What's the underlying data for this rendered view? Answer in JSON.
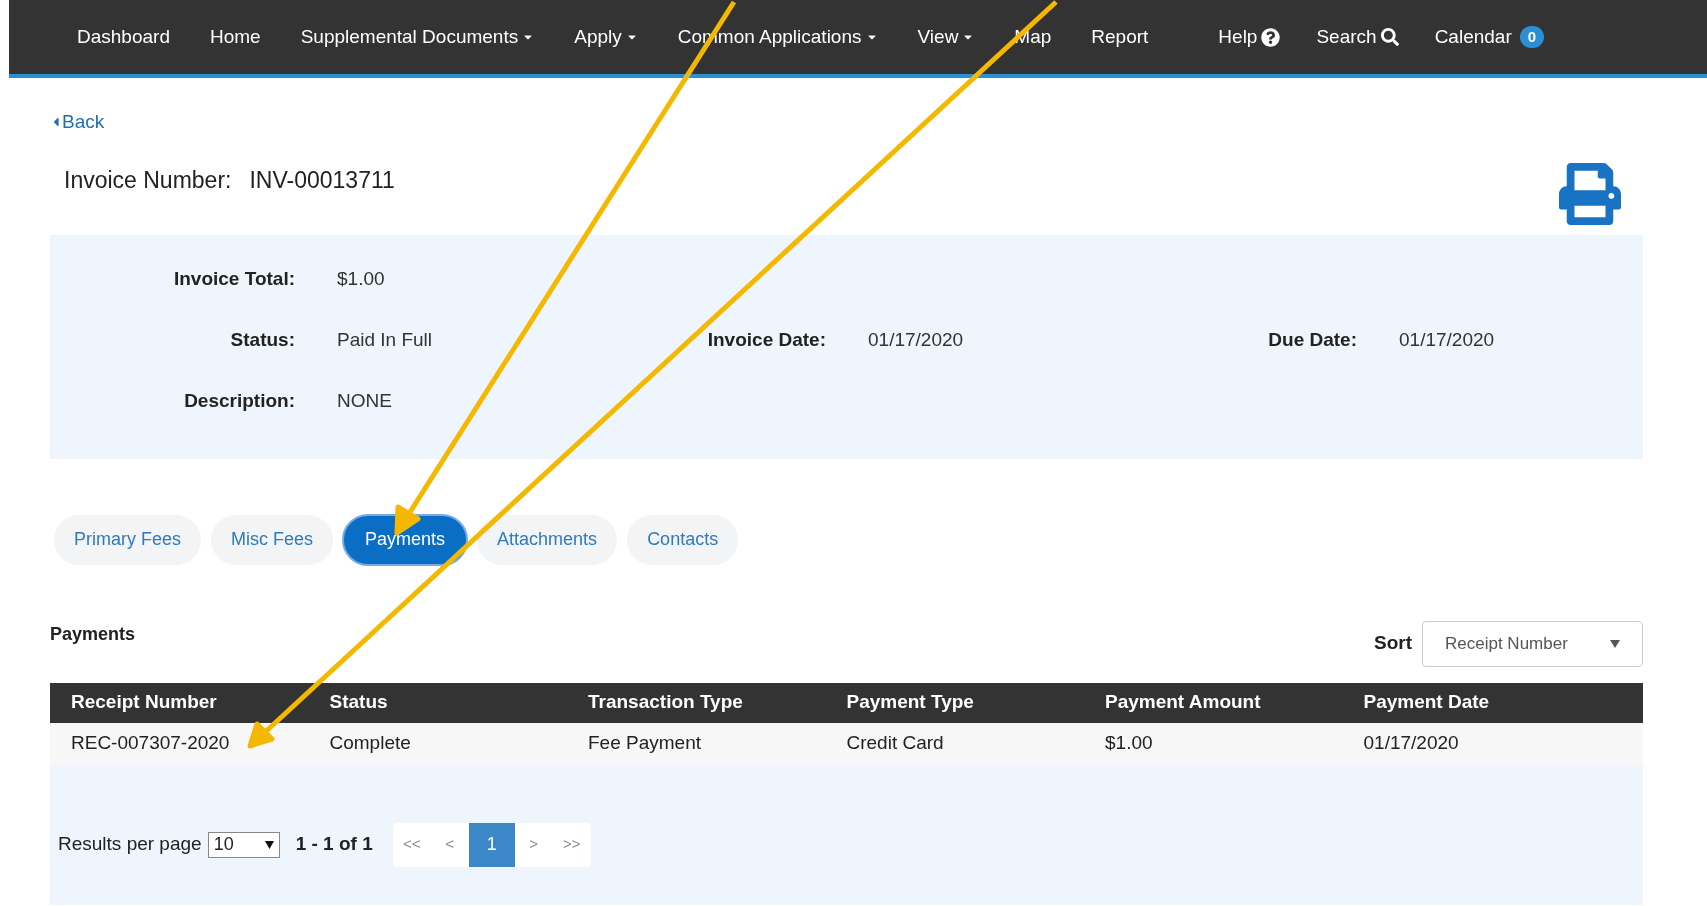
{
  "nav": {
    "items": [
      {
        "label": "Dashboard",
        "dropdown": false
      },
      {
        "label": "Home",
        "dropdown": false
      },
      {
        "label": "Supplemental Documents",
        "dropdown": true
      },
      {
        "label": "Apply",
        "dropdown": true
      },
      {
        "label": "Common Applications",
        "dropdown": true
      },
      {
        "label": "View",
        "dropdown": true
      },
      {
        "label": "Map",
        "dropdown": false
      },
      {
        "label": "Report",
        "dropdown": false
      }
    ],
    "right": [
      {
        "label": "Help",
        "kind": "help"
      },
      {
        "label": "Search",
        "kind": "search"
      },
      {
        "label": "Calendar",
        "kind": "badge",
        "badge": "0"
      }
    ]
  },
  "back": "Back",
  "invoice": {
    "label": "Invoice Number:",
    "number": "INV-00013711"
  },
  "info_rows": [
    [
      {
        "label": "Invoice Total:",
        "value": "$1.00"
      }
    ],
    [
      {
        "label": "Status:",
        "value": "Paid In Full"
      },
      {
        "label": "Invoice Date:",
        "value": "01/17/2020"
      },
      {
        "label": "Due Date:",
        "value": "01/17/2020"
      }
    ],
    [
      {
        "label": "Description:",
        "value": "NONE"
      }
    ]
  ],
  "tabs": [
    {
      "label": "Primary Fees",
      "selected": false
    },
    {
      "label": "Misc Fees",
      "selected": false
    },
    {
      "label": "Payments",
      "selected": true
    },
    {
      "label": "Attachments",
      "selected": false
    },
    {
      "label": "Contacts",
      "selected": false
    }
  ],
  "section_title": "Payments",
  "sort": {
    "label": "Sort",
    "value": "Receipt Number"
  },
  "table": {
    "columns": [
      "Receipt Number",
      "Status",
      "Transaction Type",
      "Payment Type",
      "Payment Amount",
      "Payment Date"
    ],
    "rows": [
      [
        "REC-007307-2020",
        "Complete",
        "Fee Payment",
        "Credit Card",
        "$1.00",
        "01/17/2020"
      ]
    ]
  },
  "pagination": {
    "results_label": "Results per page",
    "per_page": "10",
    "range": "1 - 1 of 1",
    "buttons": [
      {
        "label": "<<",
        "selected": false
      },
      {
        "label": "<",
        "selected": false
      },
      {
        "label": "1",
        "selected": true
      },
      {
        "label": ">",
        "selected": false
      },
      {
        "label": ">>",
        "selected": false
      }
    ]
  }
}
